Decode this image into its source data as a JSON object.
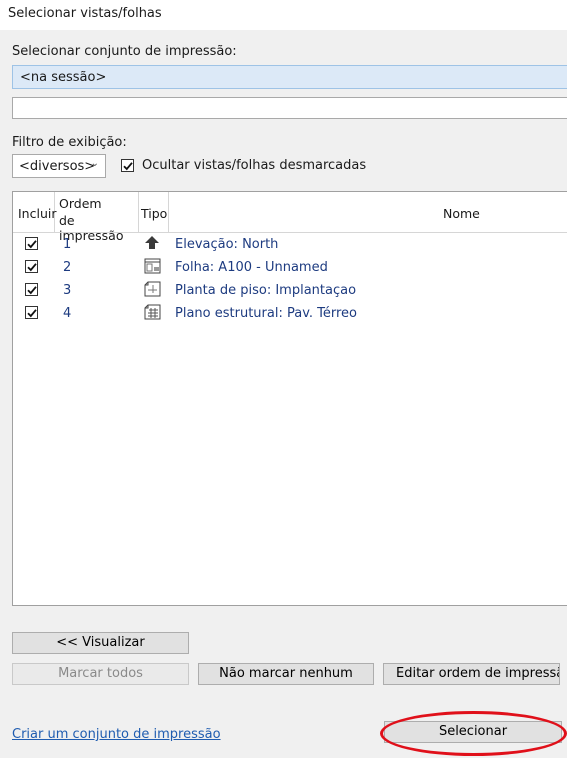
{
  "window": {
    "title": "Selecionar vistas/folhas"
  },
  "print_set": {
    "label": "Selecionar conjunto de impressão:",
    "selected": "<na sessão>",
    "name_value": ""
  },
  "filter": {
    "label": "Filtro de exibição:",
    "selected": "<diversos>",
    "hide_unchecked_label": "Ocultar vistas/folhas desmarcadas",
    "hide_unchecked_checked": true
  },
  "table": {
    "headers": {
      "include": "Incluir",
      "order_line1": "Ordem",
      "order_line2": "de impressão",
      "type": "Tipo",
      "name": "Nome"
    },
    "rows": [
      {
        "include": true,
        "order": "1",
        "type_icon": "elevation-icon",
        "name": "Elevação: North"
      },
      {
        "include": true,
        "order": "2",
        "type_icon": "sheet-icon",
        "name": "Folha: A100 - Unnamed"
      },
      {
        "include": true,
        "order": "3",
        "type_icon": "floor-plan-icon",
        "name": "Planta de piso: Implantaçao"
      },
      {
        "include": true,
        "order": "4",
        "type_icon": "structural-plan-icon",
        "name": "Plano estrutural: Pav. Térreo"
      }
    ]
  },
  "buttons": {
    "preview": "<< Visualizar",
    "check_all": "Marcar todos",
    "check_none": "Não marcar nenhum",
    "edit_order": "Editar ordem de impressão",
    "select": "Selecionar"
  },
  "link": {
    "create_set": "Criar um conjunto de impressão"
  },
  "colors": {
    "highlight_ellipse": "#e0101a",
    "link": "#1f5cb0",
    "row_text": "#1d3b80",
    "combo_selected_bg": "#dce9f7"
  }
}
